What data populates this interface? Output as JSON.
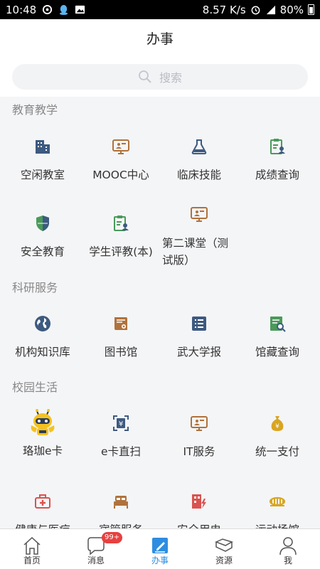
{
  "status_bar": {
    "time": "10:48",
    "speed": "8.57 K/s",
    "battery": "80%"
  },
  "header": {
    "title": "办事"
  },
  "search": {
    "placeholder": "搜索"
  },
  "sections": [
    {
      "title": "教育教学",
      "items": [
        {
          "label": "空闲教室",
          "icon": "building-icon"
        },
        {
          "label": "MOOC中心",
          "icon": "monitor-presenter-icon"
        },
        {
          "label": "临床技能",
          "icon": "flask-icon"
        },
        {
          "label": "成绩查询",
          "icon": "clipboard-user-icon"
        },
        {
          "label": "安全教育",
          "icon": "shield-icon"
        },
        {
          "label": "学生评教(本)",
          "icon": "clipboard-user-icon"
        },
        {
          "label": "第二课堂（测试版）",
          "icon": "monitor-presenter-icon"
        }
      ]
    },
    {
      "title": "科研服务",
      "items": [
        {
          "label": "机构知识库",
          "icon": "globe-icon"
        },
        {
          "label": "图书馆",
          "icon": "book-icon"
        },
        {
          "label": "武大学报",
          "icon": "list-icon"
        },
        {
          "label": "馆藏查询",
          "icon": "search-doc-icon"
        }
      ]
    },
    {
      "title": "校园生活",
      "items": [
        {
          "label": "珞珈e卡",
          "icon": "robot-mascot-icon"
        },
        {
          "label": "e卡直扫",
          "icon": "scan-yuan-icon"
        },
        {
          "label": "IT服务",
          "icon": "monitor-presenter-icon"
        },
        {
          "label": "统一支付",
          "icon": "money-bag-icon"
        },
        {
          "label": "健康与医疗",
          "icon": "medical-kit-icon"
        },
        {
          "label": "宿管服务",
          "icon": "bed-icon"
        },
        {
          "label": "安全用电",
          "icon": "building-bolt-icon"
        },
        {
          "label": "运动场馆",
          "icon": "stadium-icon"
        }
      ]
    }
  ],
  "tabs": [
    {
      "label": "首页",
      "icon": "home-icon"
    },
    {
      "label": "消息",
      "icon": "chat-icon",
      "badge": "99+"
    },
    {
      "label": "办事",
      "icon": "edit-icon",
      "active": true
    },
    {
      "label": "资源",
      "icon": "layers-icon"
    },
    {
      "label": "我",
      "icon": "user-icon"
    }
  ],
  "colors": {
    "accent": "#2d8de0",
    "icon_brown": "#b0723c",
    "icon_navy": "#3d5a80",
    "icon_green": "#4a9a5a",
    "badge": "#e84040"
  }
}
